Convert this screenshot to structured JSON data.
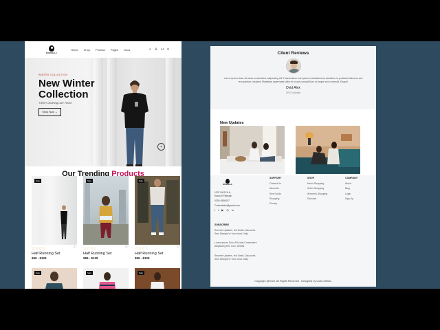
{
  "nav": {
    "brand": "MONCELLE",
    "links": [
      "Home",
      "Shop",
      "Product",
      "Pages",
      "Docs"
    ],
    "icons": [
      "search-icon",
      "user-icon",
      "cart-icon",
      "menu-icon"
    ]
  },
  "hero": {
    "kicker": "WINTER COLLECTION",
    "title": "New Winter Collection",
    "subtitle": "There's Nothing Like Trend",
    "button": "Shop Now →"
  },
  "trending": {
    "title_prefix": "Our Trending ",
    "title_highlight": "Products",
    "products": [
      {
        "badge": "Sale",
        "stars": "☆☆☆☆",
        "name": "Half Running Set",
        "price": "$99 - $129"
      },
      {
        "badge": "Sale",
        "stars": "☆☆☆☆",
        "name": "Half Running Set",
        "price": "$99 - $129"
      },
      {
        "badge": "Sale",
        "stars": "☆☆☆☆",
        "name": "Half Running Set",
        "price": "$99 - $129"
      }
    ],
    "row2_badges": [
      "Sale",
      "Sale",
      "Sale"
    ]
  },
  "reviews": {
    "title": "Client Reviews",
    "quote": "Lorem ipsum dolor sit amet consectetur, adipisicing elit. Praesentium iure ipsum exercitationem doloribus in provident laborum sed recusandae voluptas! Molestiae aspernatur dolor et ut aut corrupti illum ut eaque sed commodi. Eaque!",
    "name": "Dvid Alex",
    "role": "CEO of Addle"
  },
  "updates": {
    "title": "New Updates"
  },
  "footer": {
    "brand": "MONCELLE",
    "address": [
      "1207 BLOCK A,",
      "Karachi Pakistan",
      "0300-4560007",
      "Codeartistic@gmail.com"
    ],
    "social_icons": [
      "facebook-icon",
      "twitter-icon",
      "youtube-icon",
      "instagram-icon",
      "linkedin-icon"
    ],
    "subscribe_title": "SUBSCRIBE",
    "subscribe_texts": [
      "Receive Updates, Hot Deals, Discounts Sent Straight In Your Inbox Daily",
      "Lorem Ipsum Dolor Sit Amet Consectetur Adipisicing Elit. Cum, Debitis.",
      "Receive Updates, Hot Deals, Discounts Sent Straight In Your Inbox Daily"
    ],
    "columns": [
      {
        "heading": "SUPPORT",
        "items": [
          "Contact Us",
          "About Us",
          "Size Guide",
          "Shopping",
          "Privacy"
        ]
      },
      {
        "heading": "SHOP",
        "items": [
          "Men's Shopping",
          "Kids's Shopping",
          "Women's Shopping",
          "Discount"
        ]
      },
      {
        "heading": "COMPANY",
        "items": [
          "About",
          "Blog",
          "Login",
          "Sign Up"
        ]
      }
    ],
    "copyright": "Copyright @2023, All Rights Reserved . Designed by Code Artistic."
  },
  "colors": {
    "accent": "#c2185b",
    "background": "#2d4a5e",
    "star": "#e6a23c"
  }
}
